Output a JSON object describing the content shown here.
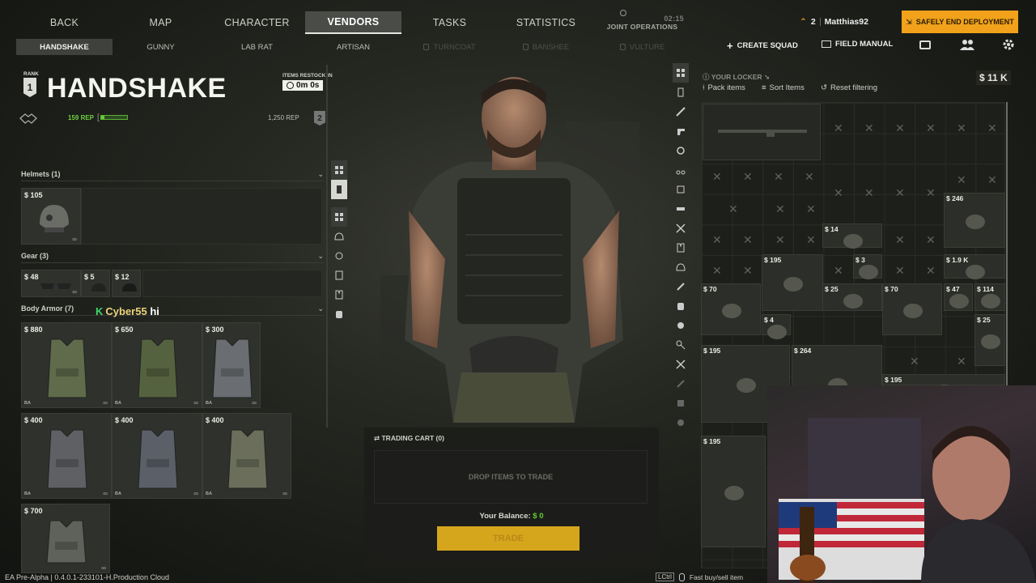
{
  "topnav": {
    "tabs": [
      "BACK",
      "MAP",
      "CHARACTER",
      "VENDORS",
      "TASKS",
      "STATISTICS"
    ],
    "joint_ops_label": "JOINT OPERATIONS",
    "joint_ops_time": "02:15"
  },
  "subnav": {
    "vendors": [
      "HANDSHAKE",
      "GUNNY",
      "LAB RAT",
      "ARTISAN",
      "TURNCOAT",
      "BANSHEE",
      "VULTURE"
    ]
  },
  "vendor": {
    "rank_label": "RANK",
    "rank_value": "1",
    "name": "HANDSHAKE",
    "restock_label": "ITEMS RESTOCK IN",
    "restock_time": "0m 0s",
    "rep_current": "159 REP",
    "rep_progress": 0.13,
    "rep_next": "1,250 REP",
    "next_rank": "2"
  },
  "categories": {
    "helmets": "Helmets (1)",
    "gear": "Gear (3)",
    "body_armor": "Body Armor (7)"
  },
  "helmet_items": [
    {
      "price": "$ 105"
    }
  ],
  "gear_items": [
    {
      "price": "$ 48"
    },
    {
      "price": "$ 5"
    },
    {
      "price": "$ 12"
    }
  ],
  "armor_items": [
    {
      "price": "$ 880",
      "tag": "BA"
    },
    {
      "price": "$ 650",
      "tag": "BA"
    },
    {
      "price": "$ 300",
      "tag": "BA"
    },
    {
      "price": "$ 400",
      "tag": "BA"
    },
    {
      "price": "$ 400",
      "tag": "BA"
    },
    {
      "price": "$ 400",
      "tag": "BA"
    },
    {
      "price": "$ 700",
      "tag": ""
    }
  ],
  "chat": {
    "user": "Cyber55",
    "message": "hi"
  },
  "cart": {
    "title": "TRADING CART (0)",
    "drop_text": "DROP ITEMS TO TRADE",
    "balance_label": "Your Balance:",
    "balance_value": "$ 0",
    "trade_button": "TRADE"
  },
  "right_header": {
    "squad_count": "2",
    "player": "Matthias92",
    "safely_end": "SAFELY END DEPLOYMENT",
    "create_squad": "CREATE SQUAD",
    "field_manual": "FIELD MANUAL"
  },
  "locker": {
    "title": "YOUR LOCKER",
    "money": "$ 11 K",
    "pack": "Pack items",
    "sort": "Sort Items",
    "reset": "Reset filtering",
    "prices": [
      "$ 246",
      "$ 14",
      "$ 195",
      "$ 3",
      "$ 1.9 K",
      "$ 70",
      "$ 25",
      "$ 70",
      "$ 47",
      "$ 114",
      "$ 4",
      "$ 25",
      "$ 195",
      "$ 264",
      "$ 195",
      "$ 195"
    ]
  },
  "footer": {
    "build": "EA Pre-Alpha | 0.4.0.1-233101-H.Production Cloud",
    "hint_key": "LCtrl",
    "hint": "Fast buy/sell item"
  },
  "colors": {
    "accent": "#f1a21a",
    "rep": "#66cc33",
    "chat_user": "#ead27a"
  }
}
